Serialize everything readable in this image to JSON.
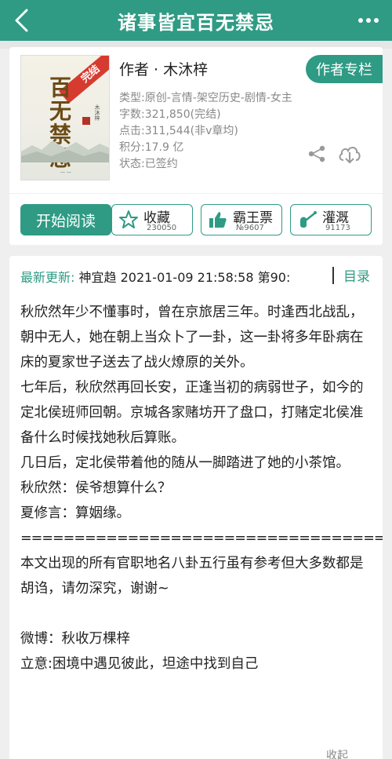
{
  "header": {
    "title": "诸事皆宜百无禁忌"
  },
  "book": {
    "cover_badge": "完结",
    "cover_title": "百无禁忌",
    "cover_author": "木沐梓",
    "author_line": "作者 · 木沐梓",
    "author_column_button": "作者专栏",
    "type": "类型:原创-言情-架空历史-剧情-女主",
    "word_count": "字数:321,850(完结)",
    "clicks": "点击:311,544(非v章均)",
    "points": "积分:17.9 亿",
    "status": "状态:已签约"
  },
  "actions": {
    "read_label": "开始阅读",
    "collect": {
      "label": "收藏",
      "count": "230050"
    },
    "bawang": {
      "label": "霸王票",
      "count": "№9607"
    },
    "guangai": {
      "label": "灌溉",
      "count": "91173"
    }
  },
  "latest": {
    "label": "最新更新:",
    "text": " 神宜趋 2021-01-09 21:58:58  第90:",
    "toc_label": "目录"
  },
  "intro": [
    "秋欣然年少不懂事时，曾在京旅居三年。时逢西北战乱，朝中无人，她在朝上当众卜了一卦，这一卦将多年卧病在床的夏家世子送去了战火燎原的关外。",
    "七年后，秋欣然再回长安，正逢当初的病弱世子，如今的定北侯班师回朝。京城各家赌坊开了盘口，打赌定北侯准备什么时候找她秋后算账。",
    "几日后，定北侯带着他的随从一脚踏进了她的小茶馆。",
    "秋欣然：侯爷想算什么？",
    "夏修言：算姻缘。",
    "======================================",
    "本文出现的所有官职地名八卦五行虽有参考但大多数都是胡诌，请勿深究，谢谢~",
    "",
    "微博：秋收万棵梓",
    "立意:困境中遇见彼此，坦途中找到自己"
  ],
  "collapse_label": "收起",
  "colors": {
    "accent": "#2f9b84",
    "badge": "#d63b2f"
  }
}
